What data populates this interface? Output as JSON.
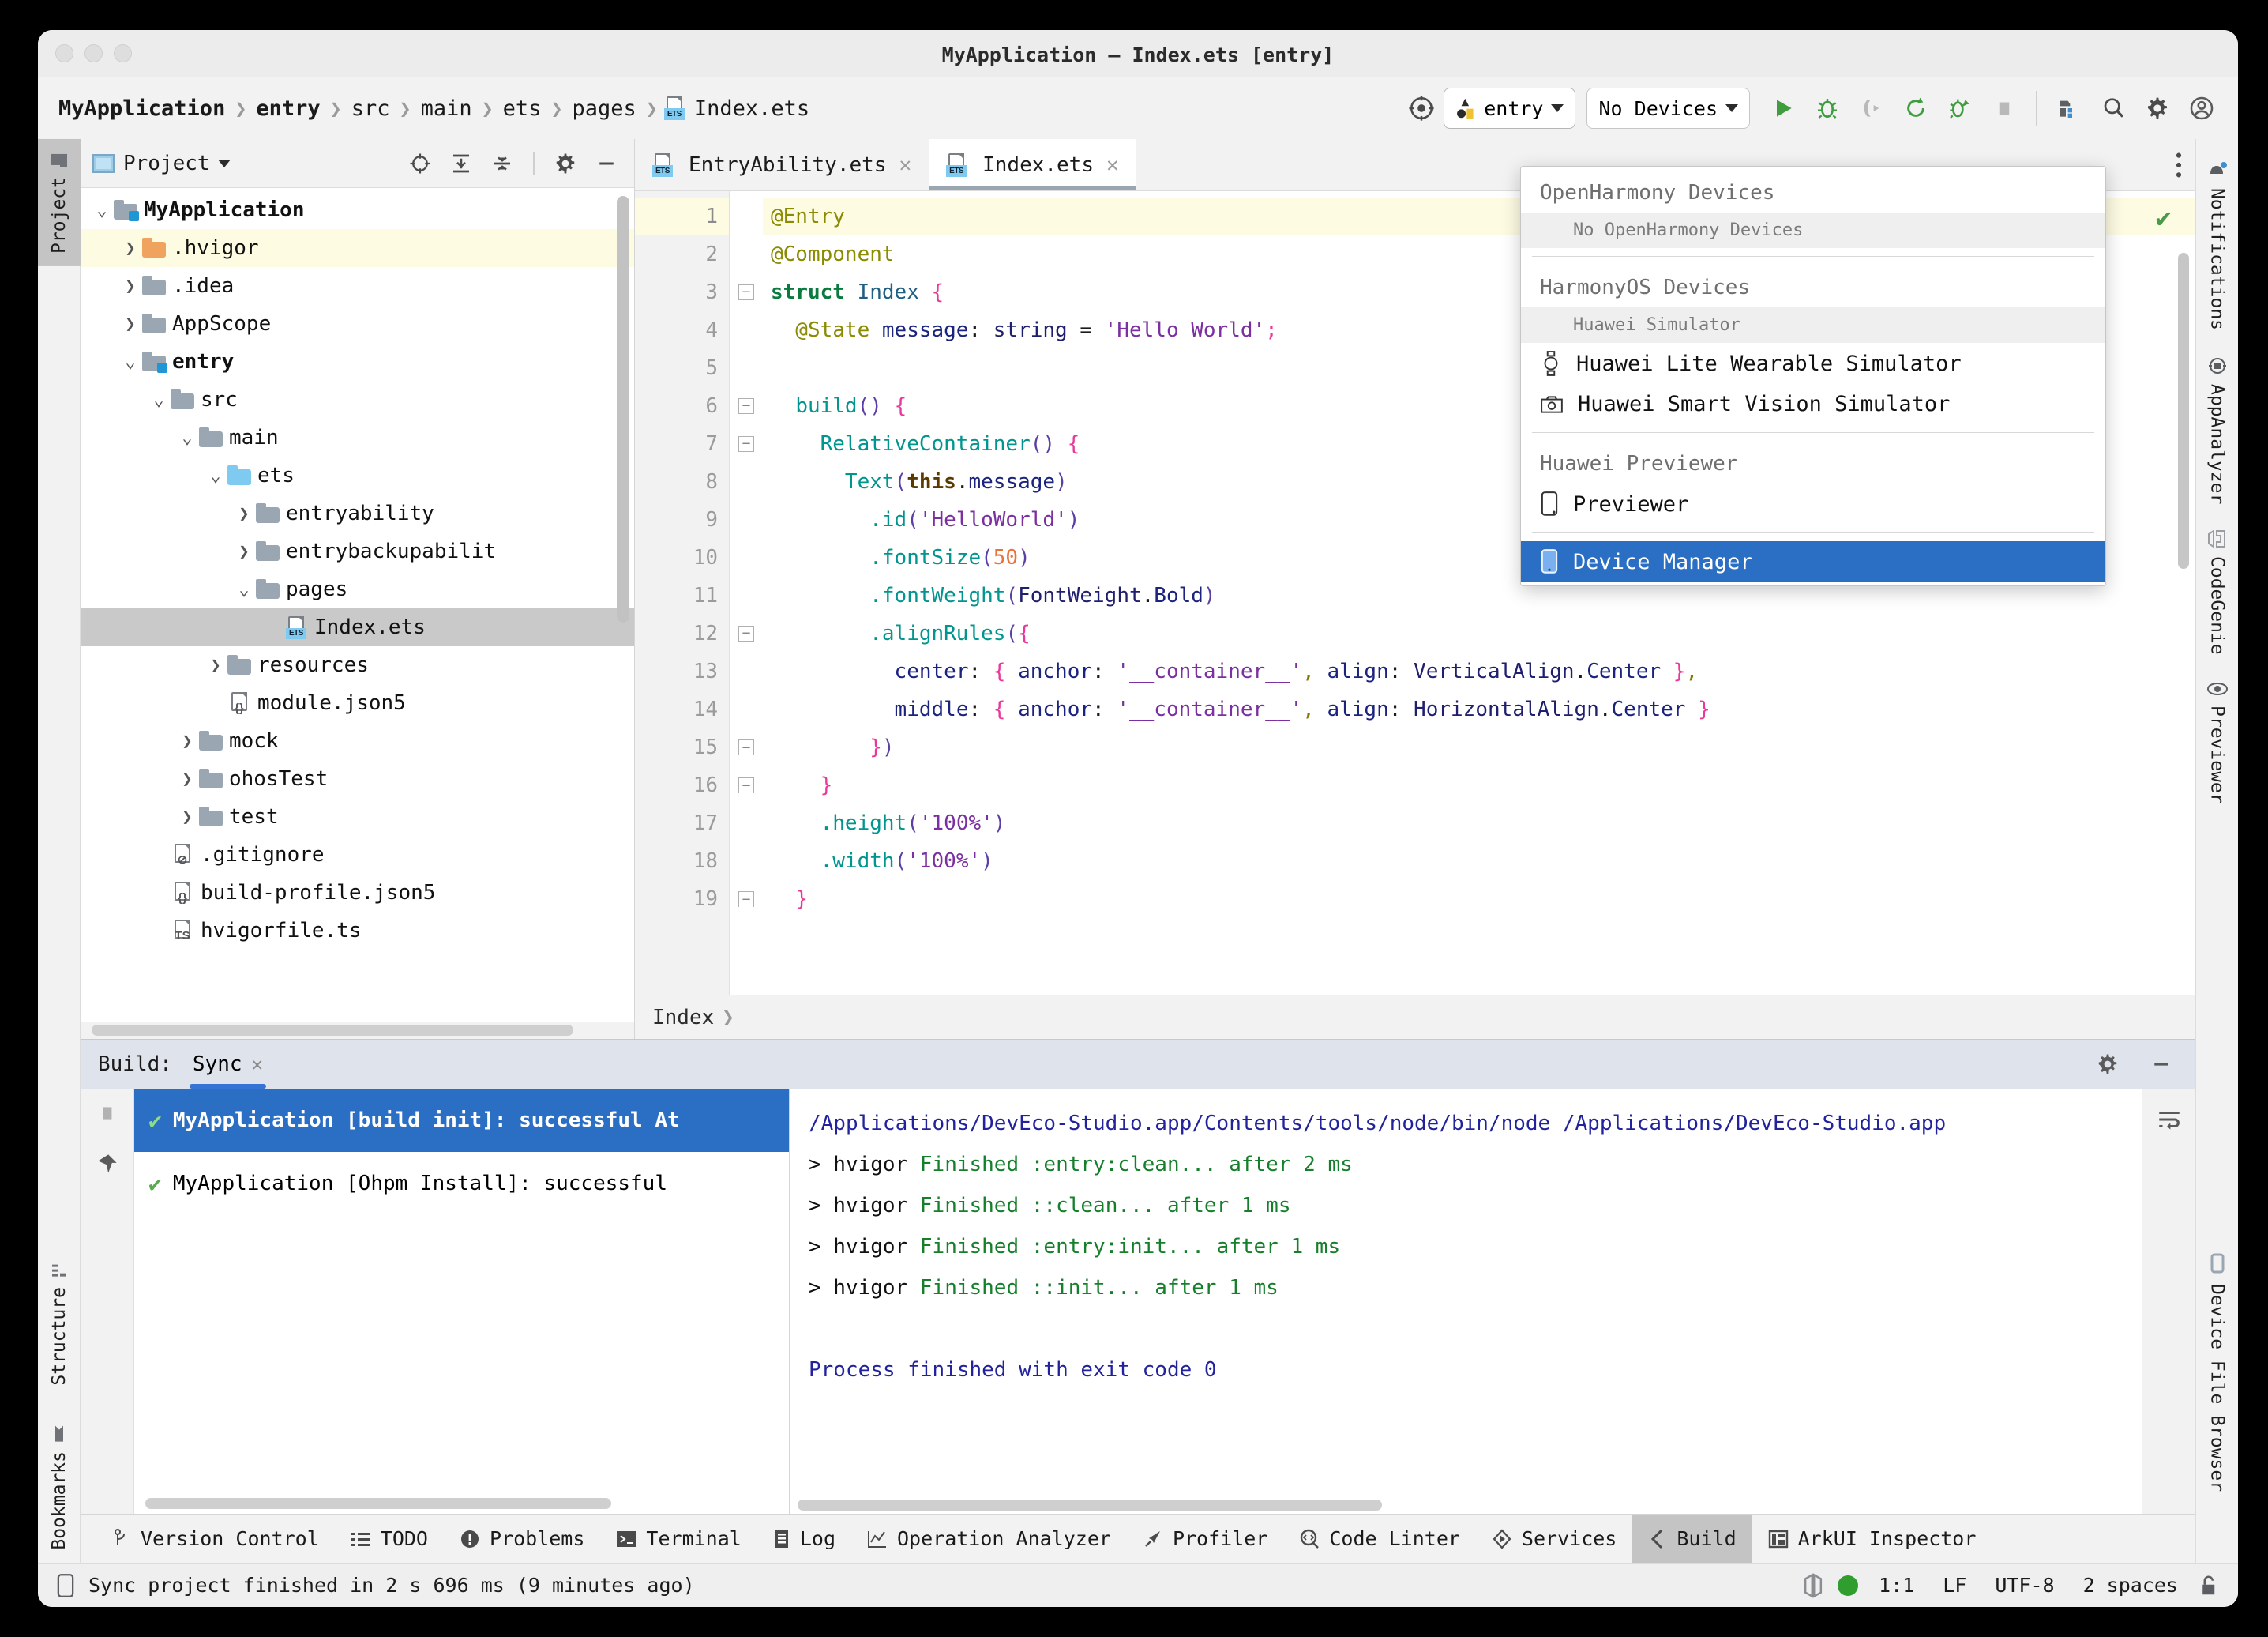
{
  "window": {
    "title": "MyApplication – Index.ets [entry]"
  },
  "breadcrumbs": {
    "items": [
      "MyApplication",
      "entry",
      "src",
      "main",
      "ets",
      "pages"
    ],
    "file": "Index.ets"
  },
  "toolbar": {
    "target_selector": "entry",
    "device_selector": "No Devices",
    "icons": [
      "target-icon",
      "run-icon",
      "debug-icon",
      "attach-debugger-icon",
      "rerun-icon",
      "profile-debug-icon",
      "stop-icon",
      "device-manager-icon",
      "search-icon",
      "settings-icon",
      "account-icon"
    ]
  },
  "device_dropdown": {
    "groups": [
      {
        "title": "OpenHarmony Devices",
        "subtitle": "No OpenHarmony Devices",
        "items": []
      },
      {
        "title": "HarmonyOS Devices",
        "subtitle": "Huawei Simulator",
        "items": [
          {
            "label": "Huawei Lite Wearable Simulator",
            "icon": "watch-icon",
            "selected": false
          },
          {
            "label": "Huawei Smart Vision Simulator",
            "icon": "camera-icon",
            "selected": false
          }
        ]
      },
      {
        "title": "Huawei Previewer",
        "subtitle": "",
        "items": [
          {
            "label": "Previewer",
            "icon": "phone-outline-icon",
            "selected": false
          }
        ]
      }
    ],
    "footer_item": {
      "label": "Device Manager",
      "icon": "phone-blue-icon",
      "selected": true
    }
  },
  "left_rail": {
    "tabs": [
      "Project",
      "Structure",
      "Bookmarks"
    ],
    "active": "Project"
  },
  "right_rail": {
    "tabs": [
      "Notifications",
      "AppAnalyzer",
      "CodeGenie",
      "Previewer",
      "Device File Browser"
    ]
  },
  "project_panel": {
    "title": "Project",
    "header_icons": [
      "locate-icon",
      "expand-all-icon",
      "collapse-all-icon",
      "gear-icon",
      "minimize-icon"
    ],
    "tree": [
      {
        "label": "MyApplication",
        "depth": 0,
        "twisty": "v",
        "icon": "module-folder",
        "bold": true,
        "state": ""
      },
      {
        "label": ".hvigor",
        "depth": 1,
        "twisty": ">",
        "icon": "orange-folder",
        "bold": false,
        "state": "hl"
      },
      {
        "label": ".idea",
        "depth": 1,
        "twisty": ">",
        "icon": "folder",
        "bold": false,
        "state": ""
      },
      {
        "label": "AppScope",
        "depth": 1,
        "twisty": ">",
        "icon": "folder",
        "bold": false,
        "state": ""
      },
      {
        "label": "entry",
        "depth": 1,
        "twisty": "v",
        "icon": "module-folder",
        "bold": true,
        "state": ""
      },
      {
        "label": "src",
        "depth": 2,
        "twisty": "v",
        "icon": "folder",
        "bold": false,
        "state": ""
      },
      {
        "label": "main",
        "depth": 3,
        "twisty": "v",
        "icon": "folder",
        "bold": false,
        "state": ""
      },
      {
        "label": "ets",
        "depth": 4,
        "twisty": "v",
        "icon": "blue-folder",
        "bold": false,
        "state": ""
      },
      {
        "label": "entryability",
        "depth": 5,
        "twisty": ">",
        "icon": "folder",
        "bold": false,
        "state": ""
      },
      {
        "label": "entrybackupabilit",
        "depth": 5,
        "twisty": ">",
        "icon": "folder",
        "bold": false,
        "state": ""
      },
      {
        "label": "pages",
        "depth": 5,
        "twisty": "v",
        "icon": "folder",
        "bold": false,
        "state": ""
      },
      {
        "label": "Index.ets",
        "depth": 6,
        "twisty": "",
        "icon": "ets-file",
        "bold": false,
        "state": "sel"
      },
      {
        "label": "resources",
        "depth": 4,
        "twisty": ">",
        "icon": "folder",
        "bold": false,
        "state": ""
      },
      {
        "label": "module.json5",
        "depth": 4,
        "twisty": "",
        "icon": "json5-file",
        "bold": false,
        "state": ""
      },
      {
        "label": "mock",
        "depth": 3,
        "twisty": ">",
        "icon": "folder",
        "bold": false,
        "state": ""
      },
      {
        "label": "ohosTest",
        "depth": 3,
        "twisty": ">",
        "icon": "folder",
        "bold": false,
        "state": ""
      },
      {
        "label": "test",
        "depth": 3,
        "twisty": ">",
        "icon": "folder",
        "bold": false,
        "state": ""
      },
      {
        "label": ".gitignore",
        "depth": 2,
        "twisty": "",
        "icon": "gitignore-file",
        "bold": false,
        "state": ""
      },
      {
        "label": "build-profile.json5",
        "depth": 2,
        "twisty": "",
        "icon": "json5-file",
        "bold": false,
        "state": ""
      },
      {
        "label": "hvigorfile.ts",
        "depth": 2,
        "twisty": "",
        "icon": "ts-file",
        "bold": false,
        "state": ""
      }
    ]
  },
  "editor": {
    "tabs": [
      {
        "label": "EntryAbility.ets",
        "active": false
      },
      {
        "label": "Index.ets",
        "active": true
      }
    ],
    "breadcrumb": "Index",
    "inspection_status": "ok",
    "lines": [
      {
        "n": 1,
        "hl": true,
        "fold": "",
        "tokens": [
          {
            "t": "@Entry",
            "c": "k-ann"
          }
        ]
      },
      {
        "n": 2,
        "hl": false,
        "fold": "",
        "tokens": [
          {
            "t": "@Component",
            "c": "k-ann"
          }
        ]
      },
      {
        "n": 3,
        "hl": false,
        "fold": "-",
        "tokens": [
          {
            "t": "struct",
            "c": "k-kw"
          },
          {
            "t": " ",
            "c": ""
          },
          {
            "t": "Index",
            "c": "k-type"
          },
          {
            "t": " ",
            "c": ""
          },
          {
            "t": "{",
            "c": "k-brace"
          }
        ]
      },
      {
        "n": 4,
        "hl": false,
        "fold": "",
        "tokens": [
          {
            "t": "  @State",
            "c": "k-ann"
          },
          {
            "t": " ",
            "c": ""
          },
          {
            "t": "message",
            "c": "k-prop"
          },
          {
            "t": ": ",
            "c": ""
          },
          {
            "t": "string",
            "c": "k-id"
          },
          {
            "t": " = ",
            "c": ""
          },
          {
            "t": "'Hello World'",
            "c": "k-str"
          },
          {
            "t": ";",
            "c": "k-brace"
          }
        ]
      },
      {
        "n": 5,
        "hl": false,
        "fold": "",
        "tokens": []
      },
      {
        "n": 6,
        "hl": false,
        "fold": "-",
        "tokens": [
          {
            "t": "  ",
            "c": ""
          },
          {
            "t": "build",
            "c": "k-fn"
          },
          {
            "t": "()",
            "c": "k-paren"
          },
          {
            "t": " ",
            "c": ""
          },
          {
            "t": "{",
            "c": "k-brace"
          }
        ]
      },
      {
        "n": 7,
        "hl": false,
        "fold": "-",
        "tokens": [
          {
            "t": "    ",
            "c": ""
          },
          {
            "t": "RelativeContainer",
            "c": "k-fn"
          },
          {
            "t": "()",
            "c": "k-paren"
          },
          {
            "t": " ",
            "c": ""
          },
          {
            "t": "{",
            "c": "k-brace"
          }
        ]
      },
      {
        "n": 8,
        "hl": false,
        "fold": "",
        "tokens": [
          {
            "t": "      ",
            "c": ""
          },
          {
            "t": "Text",
            "c": "k-fn"
          },
          {
            "t": "(",
            "c": "k-paren"
          },
          {
            "t": "this",
            "c": "k-this"
          },
          {
            "t": ".",
            "c": ""
          },
          {
            "t": "message",
            "c": "k-prop"
          },
          {
            "t": ")",
            "c": "k-paren"
          }
        ]
      },
      {
        "n": 9,
        "hl": false,
        "fold": "",
        "tokens": [
          {
            "t": "        .",
            "c": "k-fn"
          },
          {
            "t": "id",
            "c": "k-fn"
          },
          {
            "t": "(",
            "c": "k-paren"
          },
          {
            "t": "'HelloWorld'",
            "c": "k-str"
          },
          {
            "t": ")",
            "c": "k-paren"
          }
        ]
      },
      {
        "n": 10,
        "hl": false,
        "fold": "",
        "tokens": [
          {
            "t": "        .",
            "c": "k-fn"
          },
          {
            "t": "fontSize",
            "c": "k-fn"
          },
          {
            "t": "(",
            "c": "k-paren"
          },
          {
            "t": "50",
            "c": "k-num"
          },
          {
            "t": ")",
            "c": "k-paren"
          }
        ]
      },
      {
        "n": 11,
        "hl": false,
        "fold": "",
        "tokens": [
          {
            "t": "        .",
            "c": "k-fn"
          },
          {
            "t": "fontWeight",
            "c": "k-fn"
          },
          {
            "t": "(",
            "c": "k-paren"
          },
          {
            "t": "FontWeight",
            "c": "k-id"
          },
          {
            "t": ".",
            "c": ""
          },
          {
            "t": "Bold",
            "c": "k-prop"
          },
          {
            "t": ")",
            "c": "k-paren"
          }
        ]
      },
      {
        "n": 12,
        "hl": false,
        "fold": "-",
        "tokens": [
          {
            "t": "        .",
            "c": "k-fn"
          },
          {
            "t": "alignRules",
            "c": "k-fn"
          },
          {
            "t": "(",
            "c": "k-paren"
          },
          {
            "t": "{",
            "c": "k-brace"
          }
        ]
      },
      {
        "n": 13,
        "hl": false,
        "fold": "",
        "tokens": [
          {
            "t": "          ",
            "c": ""
          },
          {
            "t": "center",
            "c": "k-prop"
          },
          {
            "t": ": ",
            "c": ""
          },
          {
            "t": "{",
            "c": "k-brace"
          },
          {
            "t": " ",
            "c": ""
          },
          {
            "t": "anchor",
            "c": "k-prop"
          },
          {
            "t": ": ",
            "c": ""
          },
          {
            "t": "'__container__'",
            "c": "k-str"
          },
          {
            "t": ",",
            "c": "k-comma"
          },
          {
            "t": " ",
            "c": ""
          },
          {
            "t": "align",
            "c": "k-prop"
          },
          {
            "t": ": ",
            "c": ""
          },
          {
            "t": "VerticalAlign",
            "c": "k-id"
          },
          {
            "t": ".",
            "c": ""
          },
          {
            "t": "Center",
            "c": "k-prop"
          },
          {
            "t": " ",
            "c": ""
          },
          {
            "t": "}",
            "c": "k-brace"
          },
          {
            "t": ",",
            "c": "k-comma"
          }
        ]
      },
      {
        "n": 14,
        "hl": false,
        "fold": "",
        "tokens": [
          {
            "t": "          ",
            "c": ""
          },
          {
            "t": "middle",
            "c": "k-prop"
          },
          {
            "t": ": ",
            "c": ""
          },
          {
            "t": "{",
            "c": "k-brace"
          },
          {
            "t": " ",
            "c": ""
          },
          {
            "t": "anchor",
            "c": "k-prop"
          },
          {
            "t": ": ",
            "c": ""
          },
          {
            "t": "'__container__'",
            "c": "k-str"
          },
          {
            "t": ",",
            "c": "k-comma"
          },
          {
            "t": " ",
            "c": ""
          },
          {
            "t": "align",
            "c": "k-prop"
          },
          {
            "t": ": ",
            "c": ""
          },
          {
            "t": "HorizontalAlign",
            "c": "k-id"
          },
          {
            "t": ".",
            "c": ""
          },
          {
            "t": "Center",
            "c": "k-prop"
          },
          {
            "t": " ",
            "c": ""
          },
          {
            "t": "}",
            "c": "k-brace"
          }
        ]
      },
      {
        "n": 15,
        "hl": false,
        "fold": "^",
        "tokens": [
          {
            "t": "        ",
            "c": ""
          },
          {
            "t": "}",
            "c": "k-brace"
          },
          {
            "t": ")",
            "c": "k-paren"
          }
        ]
      },
      {
        "n": 16,
        "hl": false,
        "fold": "^",
        "tokens": [
          {
            "t": "    ",
            "c": ""
          },
          {
            "t": "}",
            "c": "k-brace"
          }
        ]
      },
      {
        "n": 17,
        "hl": false,
        "fold": "",
        "tokens": [
          {
            "t": "    .",
            "c": "k-fn"
          },
          {
            "t": "height",
            "c": "k-fn"
          },
          {
            "t": "(",
            "c": "k-paren"
          },
          {
            "t": "'100%'",
            "c": "k-str"
          },
          {
            "t": ")",
            "c": "k-paren"
          }
        ]
      },
      {
        "n": 18,
        "hl": false,
        "fold": "",
        "tokens": [
          {
            "t": "    .",
            "c": "k-fn"
          },
          {
            "t": "width",
            "c": "k-fn"
          },
          {
            "t": "(",
            "c": "k-paren"
          },
          {
            "t": "'100%'",
            "c": "k-str"
          },
          {
            "t": ")",
            "c": "k-paren"
          }
        ]
      },
      {
        "n": 19,
        "hl": false,
        "fold": "^",
        "tokens": [
          {
            "t": "  ",
            "c": ""
          },
          {
            "t": "}",
            "c": "k-brace"
          }
        ]
      }
    ]
  },
  "build_panel": {
    "label": "Build:",
    "tab": "Sync",
    "header_icons": [
      "gear-icon",
      "minimize-icon"
    ],
    "gutter_icons": [
      "stop-icon",
      "pin-icon"
    ],
    "tree": [
      {
        "label": "MyApplication [Ohpm Install]: successful",
        "status": "ok",
        "selected": false
      },
      {
        "label": "MyApplication [build init]: successful At",
        "status": "ok",
        "selected": true
      }
    ],
    "log": [
      {
        "text": "/Applications/DevEco-Studio.app/Contents/tools/node/bin/node /Applications/DevEco-Studio.app",
        "style": "path"
      },
      {
        "text": "> hvigor Finished :entry:clean... after 2 ms",
        "style": "task"
      },
      {
        "text": "> hvigor Finished ::clean... after 1 ms",
        "style": "task"
      },
      {
        "text": "> hvigor Finished :entry:init... after 1 ms",
        "style": "task"
      },
      {
        "text": "> hvigor Finished ::init... after 1 ms",
        "style": "task"
      },
      {
        "text": "",
        "style": "plain"
      },
      {
        "text": "Process finished with exit code 0",
        "style": "navy"
      }
    ],
    "rail_icon": "soft-wrap-icon"
  },
  "tool_tabs": [
    {
      "label": "Version Control",
      "icon": "branch-icon",
      "active": false
    },
    {
      "label": "TODO",
      "icon": "list-icon",
      "active": false
    },
    {
      "label": "Problems",
      "icon": "exclamation-icon",
      "active": false
    },
    {
      "label": "Terminal",
      "icon": "terminal-icon",
      "active": false
    },
    {
      "label": "Log",
      "icon": "log-icon",
      "active": false
    },
    {
      "label": "Operation Analyzer",
      "icon": "chart-icon",
      "active": false
    },
    {
      "label": "Profiler",
      "icon": "profiler-icon",
      "active": false
    },
    {
      "label": "Code Linter",
      "icon": "code-linter-icon",
      "active": false
    },
    {
      "label": "Services",
      "icon": "services-icon",
      "active": false
    },
    {
      "label": "Build",
      "icon": "build-icon",
      "active": true
    },
    {
      "label": "ArkUI Inspector",
      "icon": "inspector-icon",
      "active": false
    }
  ],
  "status_bar": {
    "message": "Sync project finished in 2 s 696 ms (9 minutes ago)",
    "message_icon": "phone-outline-icon",
    "right": {
      "items": [
        "1:1",
        "LF",
        "UTF-8",
        "2 spaces"
      ],
      "icons": [
        "memory-icon",
        "status-ok-dot",
        "lock-open-icon"
      ]
    }
  }
}
